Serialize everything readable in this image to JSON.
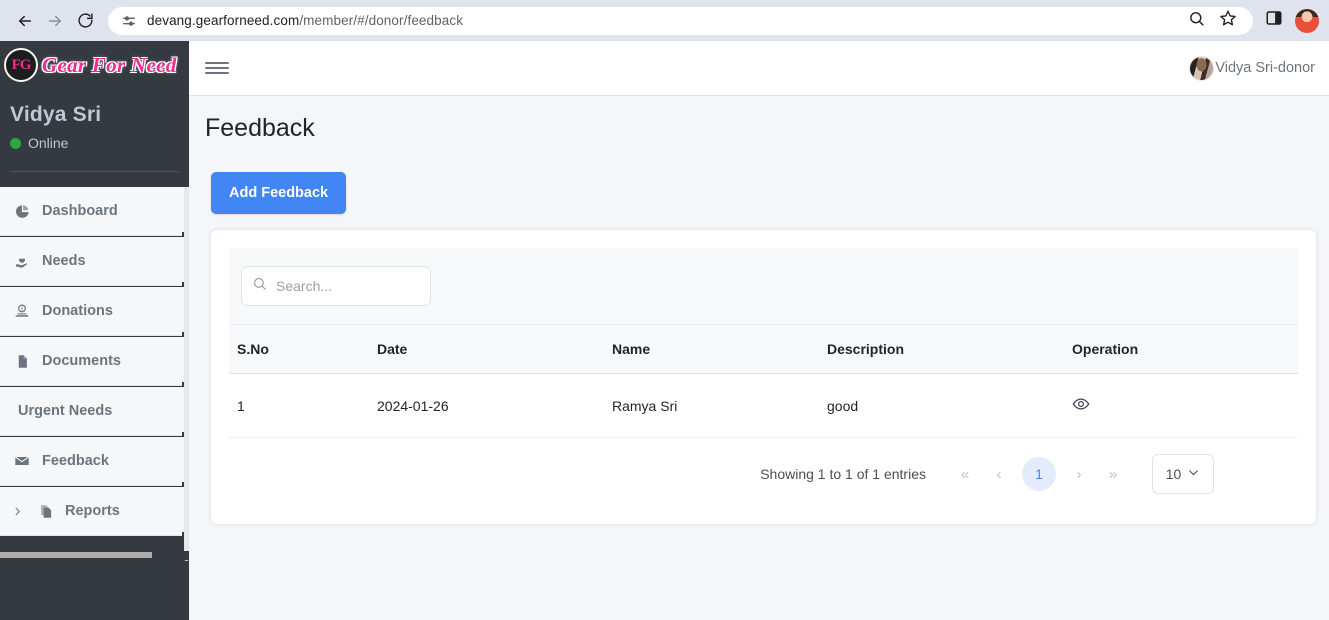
{
  "browser": {
    "url_main": "devang.gearforneed.com",
    "url_path": "/member/#/donor/feedback",
    "back_icon": "back-arrow-icon",
    "forward_icon": "forward-arrow-icon",
    "reload_icon": "reload-icon",
    "site_settings_icon": "tune-icon",
    "search_icon": "search-icon",
    "bookmark_icon": "star-icon",
    "side_panel_icon": "side-panel-icon",
    "profile_icon": "profile-avatar-icon"
  },
  "sidebar": {
    "brand": {
      "monogram": "FG",
      "text": "Gear For Need",
      "accent": "#ef2c8f"
    },
    "user": {
      "name": "Vidya Sri",
      "status": "Online",
      "status_color": "#28a745"
    },
    "items": [
      {
        "label": "Dashboard",
        "icon": "pie-chart-icon",
        "has_icon": true,
        "has_caret": false
      },
      {
        "label": "Needs",
        "icon": "hand-heart-icon",
        "has_icon": true,
        "has_caret": false
      },
      {
        "label": "Donations",
        "icon": "donate-icon",
        "has_icon": true,
        "has_caret": false
      },
      {
        "label": "Documents",
        "icon": "document-icon",
        "has_icon": true,
        "has_caret": false
      },
      {
        "label": "Urgent Needs",
        "icon": "",
        "has_icon": false,
        "has_caret": false
      },
      {
        "label": "Feedback",
        "icon": "envelope-icon",
        "has_icon": true,
        "has_caret": false
      },
      {
        "label": "Reports",
        "icon": "copy-icon",
        "has_icon": true,
        "has_caret": true
      }
    ]
  },
  "topbar": {
    "menu_icon": "hamburger-icon",
    "user_label": "Vidya Sri-donor",
    "avatar_icon": "user-avatar-icon"
  },
  "main": {
    "page_title": "Feedback",
    "add_button": "Add Feedback",
    "accent_blue": "#4285f4"
  },
  "search": {
    "placeholder": "Search...",
    "value": "",
    "icon": "search-icon"
  },
  "table": {
    "columns": [
      "S.No",
      "Date",
      "Name",
      "Description",
      "Operation"
    ],
    "rows": [
      {
        "sno": "1",
        "date": "2024-01-26",
        "name": "Ramya Sri",
        "description": "good",
        "operation_icon": "eye-icon"
      }
    ]
  },
  "pagination": {
    "info": "Showing 1 to 1 of 1 entries",
    "first_label": "«",
    "prev_label": "‹",
    "current_page": "1",
    "next_label": "›",
    "last_label": "»",
    "page_size": "10",
    "chevron_icon": "chevron-down-icon"
  }
}
